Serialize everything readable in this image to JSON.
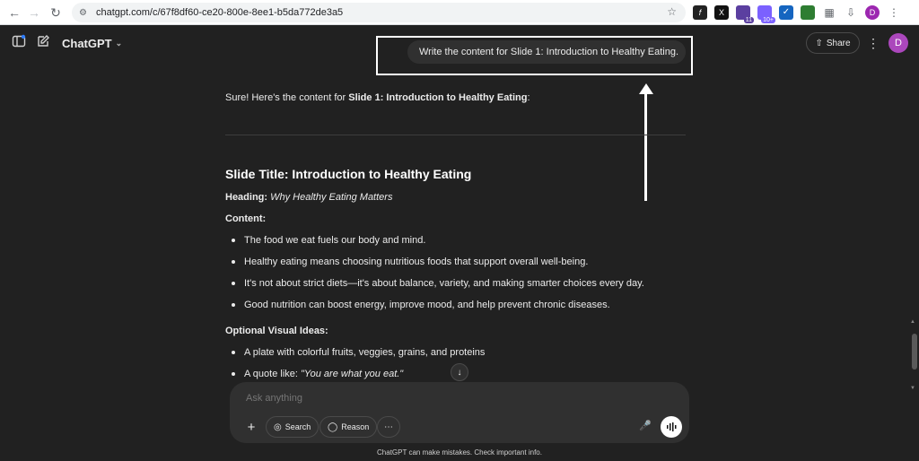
{
  "browser": {
    "url": "chatgpt.com/c/67f8df60-ce20-800e-8ee1-b5da772de3a5",
    "badge_11": "11",
    "badge_10": "10+",
    "profile_initial": "D"
  },
  "header": {
    "title": "ChatGPT",
    "share_label": "Share",
    "user_initial": "D"
  },
  "user_message": "Write the content for Slide 1: Introduction to Healthy Eating.",
  "response": {
    "intro_prefix": "Sure! Here's the content for ",
    "intro_bold": "Slide 1: Introduction to Healthy Eating",
    "intro_suffix": ":",
    "slide_title": "Slide Title: Introduction to Healthy Eating",
    "heading_label": "Heading:",
    "heading_value": "Why Healthy Eating Matters",
    "content_label": "Content:",
    "content_bullets": [
      "The food we eat fuels our body and mind.",
      "Healthy eating means choosing nutritious foods that support overall well-being.",
      "It's not about strict diets—it's about balance, variety, and making smarter choices every day.",
      "Good nutrition can boost energy, improve mood, and help prevent chronic diseases."
    ],
    "optional_label": "Optional Visual Ideas:",
    "visual_bullet_1": "A plate with colorful fruits, veggies, grains, and proteins",
    "visual_bullet_2_prefix": "A quote like: ",
    "visual_bullet_2_quote": "\"You are what you eat.\""
  },
  "composer": {
    "placeholder": "Ask anything",
    "search_label": "Search",
    "reason_label": "Reason"
  },
  "footer_note": "ChatGPT can make mistakes. Check important info.",
  "colors": {
    "background": "#212121",
    "bubble": "#303030",
    "annotation": "#ffffff"
  }
}
